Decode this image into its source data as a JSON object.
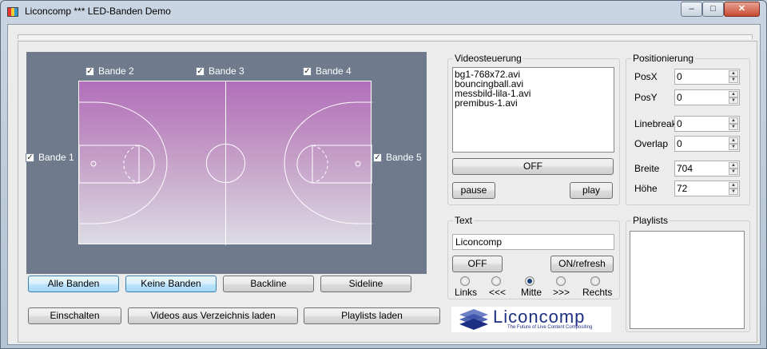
{
  "window": {
    "title": "Liconcomp *** LED-Banden Demo",
    "minimize": "‒",
    "maximize": "□",
    "close": "✕"
  },
  "bands": {
    "bande1": {
      "label": "Bande 1",
      "checked": "✓"
    },
    "bande2": {
      "label": "Bande 2",
      "checked": "✓"
    },
    "bande3": {
      "label": "Bande 3",
      "checked": "✓"
    },
    "bande4": {
      "label": "Bande 4",
      "checked": "✓"
    },
    "bande5": {
      "label": "Bande 5",
      "checked": "✓"
    }
  },
  "buttons": {
    "alle_banden": "Alle Banden",
    "keine_banden": "Keine Banden",
    "backline": "Backline",
    "sideline": "Sideline",
    "einschalten": "Einschalten",
    "videos_laden": "Videos aus Verzeichnis laden",
    "playlists_laden": "Playlists laden"
  },
  "videosteuerung": {
    "legend": "Videosteuerung",
    "files": [
      "bg1-768x72.avi",
      "bouncingball.avi",
      "messbild-lila-1.avi",
      "premibus-1.avi"
    ],
    "off": "OFF",
    "pause": "pause",
    "play": "play"
  },
  "text": {
    "legend": "Text",
    "value": "Liconcomp",
    "off": "OFF",
    "on_refresh": "ON/refresh",
    "radios": [
      "Links",
      "<<<",
      "Mitte",
      ">>>",
      "Rechts"
    ],
    "selected": "Mitte"
  },
  "positionierung": {
    "legend": "Positionierung",
    "fields": [
      {
        "label": "PosX",
        "value": "0"
      },
      {
        "label": "PosY",
        "value": "0"
      },
      {
        "label": "Linebreak",
        "value": "0"
      },
      {
        "label": "Overlap",
        "value": "0"
      },
      {
        "label": "Breite",
        "value": "704"
      },
      {
        "label": "Höhe",
        "value": "72"
      }
    ]
  },
  "playlists": {
    "legend": "Playlists"
  },
  "logo": {
    "name": "Liconcomp",
    "tagline": "The Future of Live Content Compositing"
  }
}
